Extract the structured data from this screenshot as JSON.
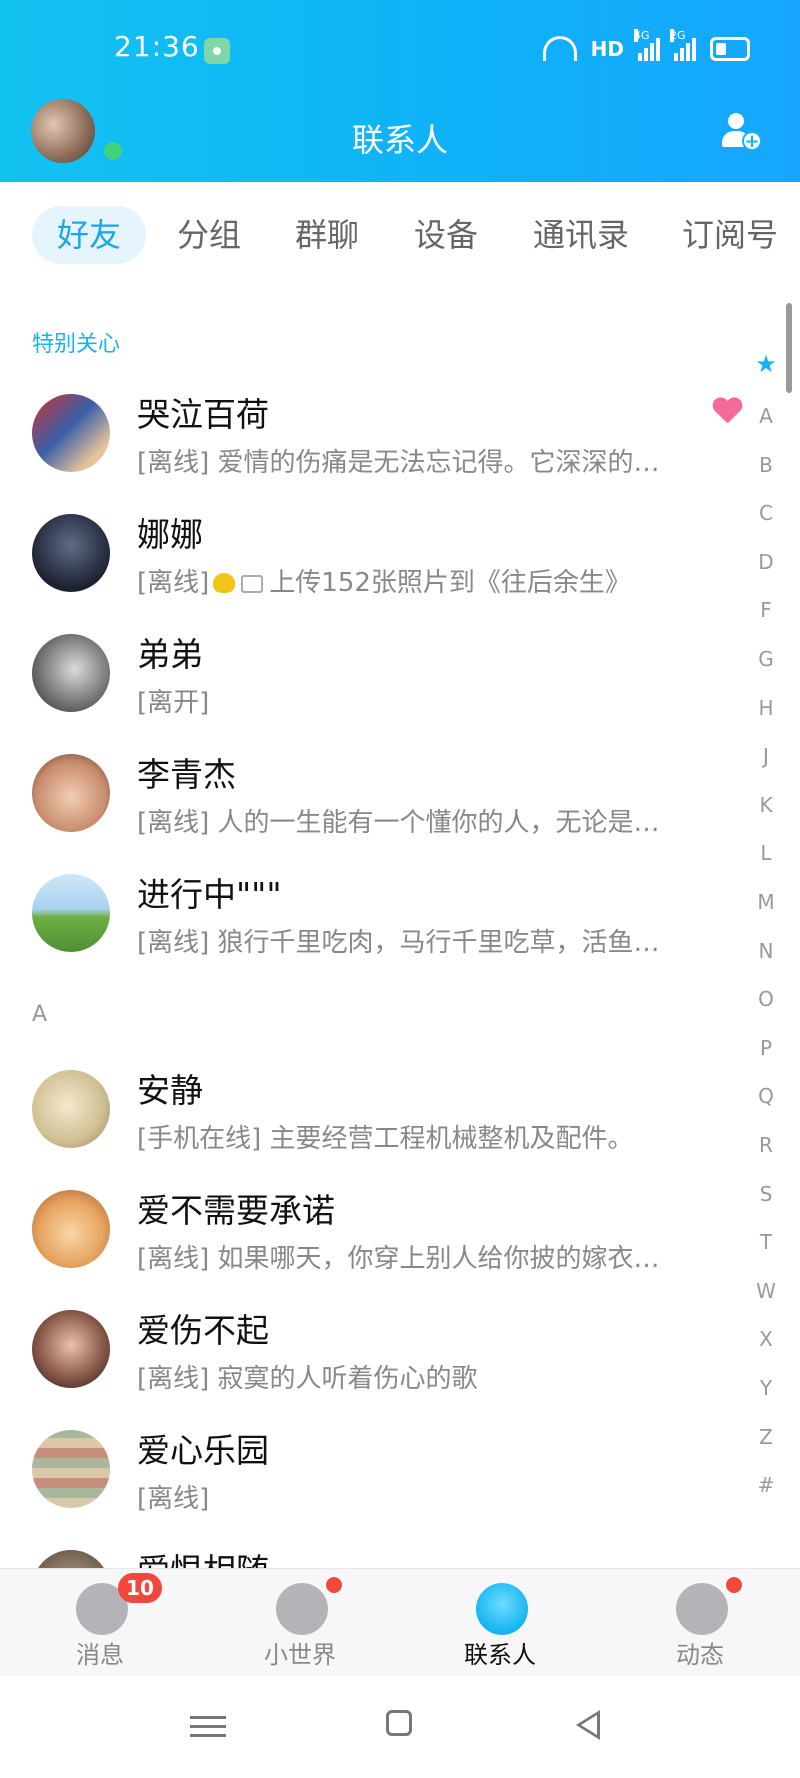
{
  "status_bar": {
    "time": "21:36",
    "network": "HD",
    "signal_1": "4G",
    "signal_2": "2G"
  },
  "header": {
    "title": "联系人"
  },
  "tabs": [
    {
      "label": "好友",
      "active": true
    },
    {
      "label": "分组"
    },
    {
      "label": "群聊"
    },
    {
      "label": "设备"
    },
    {
      "label": "通讯录"
    },
    {
      "label": "订阅号"
    }
  ],
  "sections": {
    "special": "特别关心",
    "a": "A"
  },
  "contacts": [
    {
      "name": "哭泣百荷",
      "message": "[离线] 爱情的伤痛是无法忘记得。它深深的…"
    },
    {
      "name": "娜娜",
      "message_status": "[离线]",
      "message_text": "上传152张照片到《往后余生》"
    },
    {
      "name": "弟弟",
      "message": "[离开]"
    },
    {
      "name": "李青杰",
      "message": "[离线] 人的一生能有一个懂你的人，无论是…"
    },
    {
      "name": "进行中\"\"\"",
      "message": "[离线] 狼行千里吃肉，马行千里吃草，活鱼…"
    },
    {
      "name": "安静",
      "message": "[手机在线] 主要经营工程机械整机及配件。"
    },
    {
      "name": "爱不需要承诺",
      "message": "[离线] 如果哪天，你穿上别人给你披的嫁衣…"
    },
    {
      "name": "爱伤不起",
      "message": "[离线] 寂寞的人听着伤心的歌"
    },
    {
      "name": "爱心乐园",
      "message": "[离线]"
    },
    {
      "name": "爱恨相随"
    }
  ],
  "alphabet": [
    "★",
    "A",
    "B",
    "C",
    "D",
    "F",
    "G",
    "H",
    "J",
    "K",
    "L",
    "M",
    "N",
    "O",
    "P",
    "Q",
    "R",
    "S",
    "T",
    "W",
    "X",
    "Y",
    "Z",
    "#"
  ],
  "bottom_nav": [
    {
      "label": "消息",
      "badge": "10"
    },
    {
      "label": "小世界"
    },
    {
      "label": "联系人",
      "active": true
    },
    {
      "label": "动态"
    }
  ],
  "colors": {
    "accent": "#14b4f2",
    "badge": "#f2473d"
  }
}
